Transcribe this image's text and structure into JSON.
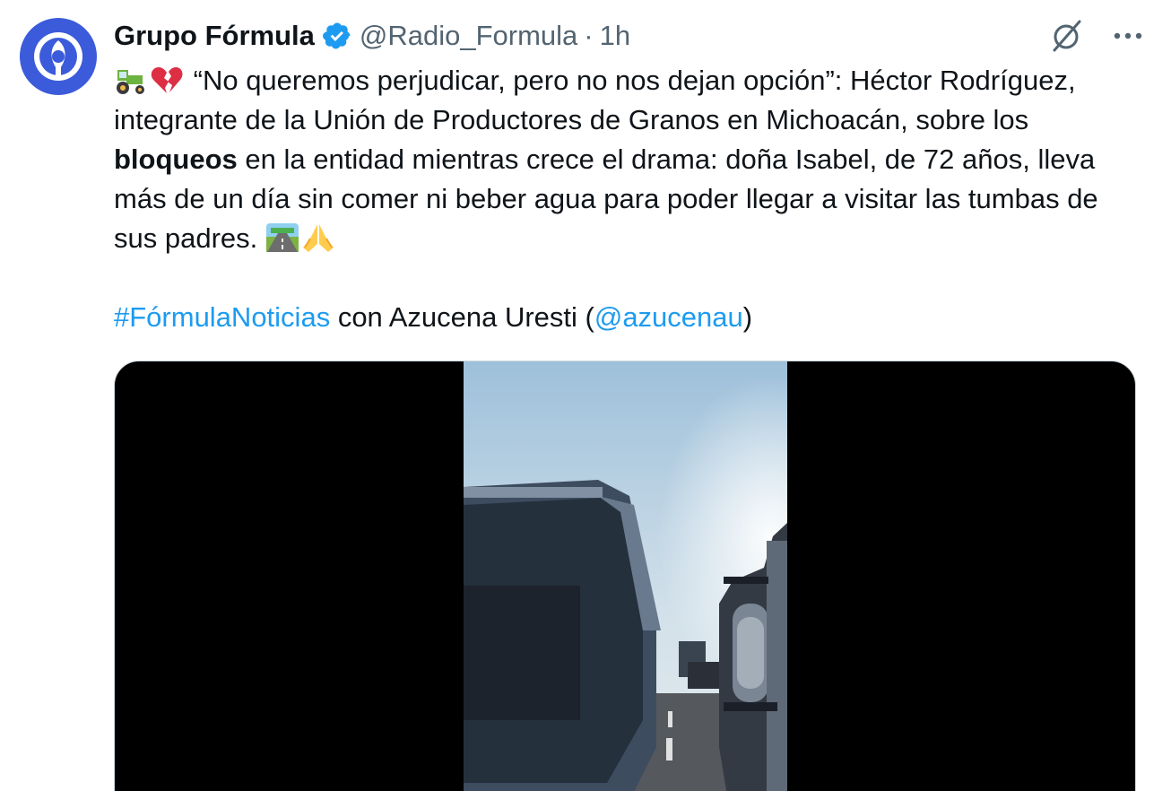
{
  "tweet": {
    "display_name": "Grupo Fórmula",
    "handle": "@Radio_Formula",
    "separator": "·",
    "time": "1h",
    "icons": {
      "avatar": "grupo-formula-logo",
      "verified": "verified-badge-icon",
      "grok": "grok-icon",
      "more": "more-options-icon"
    },
    "colors": {
      "avatar_bg": "#3b5bdb",
      "link": "#1d9bf0",
      "verified": "#1d9bf0"
    },
    "body": {
      "line1_emojis": [
        "tractor-emoji",
        "broken-heart-emoji"
      ],
      "text_part1": "“No queremos perjudicar, pero no nos dejan opción”: Héctor Rodríguez, integrante de la Unión de Productores de Granos en Michoacán, sobre los ",
      "bold_word": "bloqueos",
      "text_part2": " en la entidad mientras crece el drama: doña Isabel, de 72 años, lleva más de un día sin comer ni beber agua para poder llegar a visitar las tumbas de sus padres. ",
      "end_emojis": [
        "motorway-emoji",
        "folded-hands-emoji"
      ],
      "hashtag": "#FórmulaNoticias",
      "mid_text": " con Azucena Uresti (",
      "mention": "@azucenau",
      "close_paren": ")"
    },
    "media": {
      "type": "video",
      "description_icon": "video-thumbnail"
    }
  }
}
